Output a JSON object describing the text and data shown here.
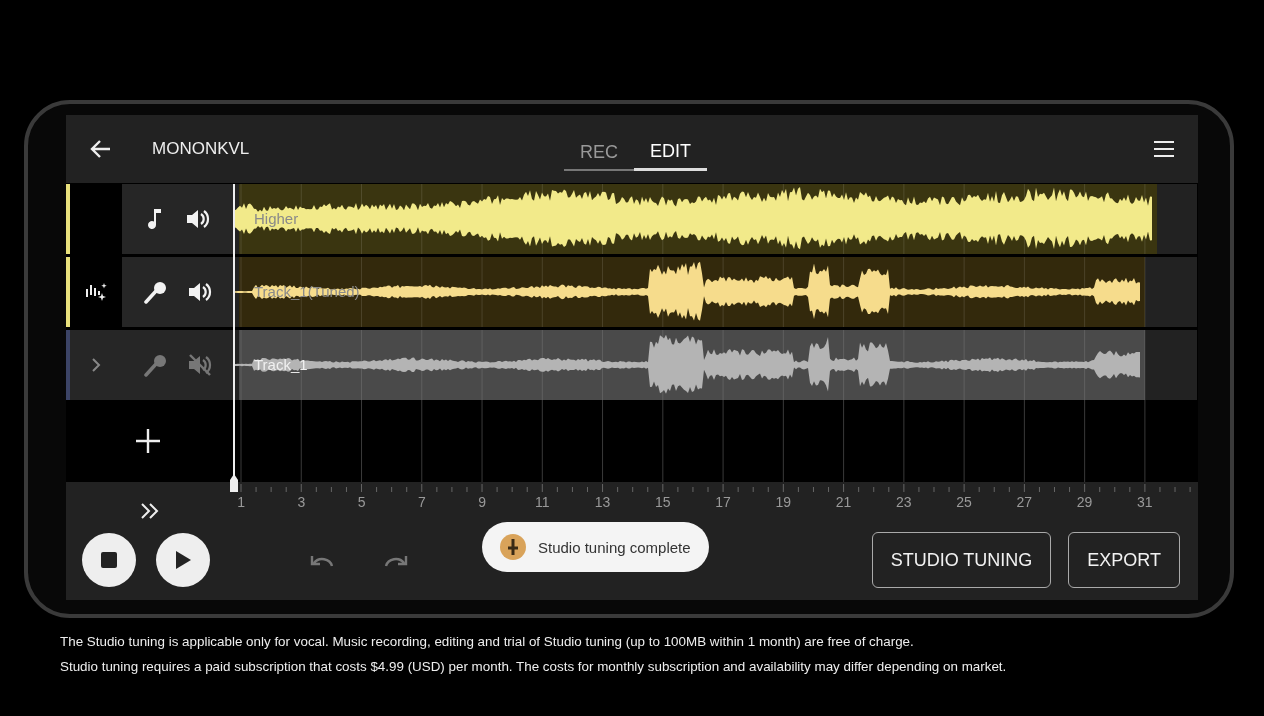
{
  "header": {
    "title": "MONONKVL",
    "tabs": [
      {
        "label": "REC",
        "selected": false
      },
      {
        "label": "EDIT",
        "selected": true
      }
    ]
  },
  "tracks": [
    {
      "name": "Higher",
      "kind": "instrument",
      "selected": true,
      "muted": false,
      "tuned": false,
      "color": "#f2ea8a"
    },
    {
      "name": "Track_1(Tuned)",
      "kind": "vocal",
      "selected": true,
      "muted": false,
      "tuned": true,
      "color": "#f6dc8c"
    },
    {
      "name": "Track_1",
      "kind": "vocal",
      "selected": false,
      "muted": true,
      "tuned": false,
      "color": "#b4b4b4"
    }
  ],
  "timeline": {
    "bars": [
      "1",
      "3",
      "5",
      "7",
      "9",
      "11",
      "13",
      "15",
      "17",
      "19",
      "21",
      "23",
      "25",
      "27",
      "29",
      "31"
    ]
  },
  "toast": {
    "text": "Studio tuning complete"
  },
  "buttons": [
    "STUDIO TUNING",
    "EXPORT"
  ],
  "caption": [
    "The Studio tuning is applicable only for vocal. Music recording, editing and trial of Studio tuning (up to 100MB within 1 month) are free of charge.",
    "Studio tuning requires a paid subscription that costs $4.99 (USD) per month. The costs for monthly subscription and availability may differ depending on market."
  ]
}
